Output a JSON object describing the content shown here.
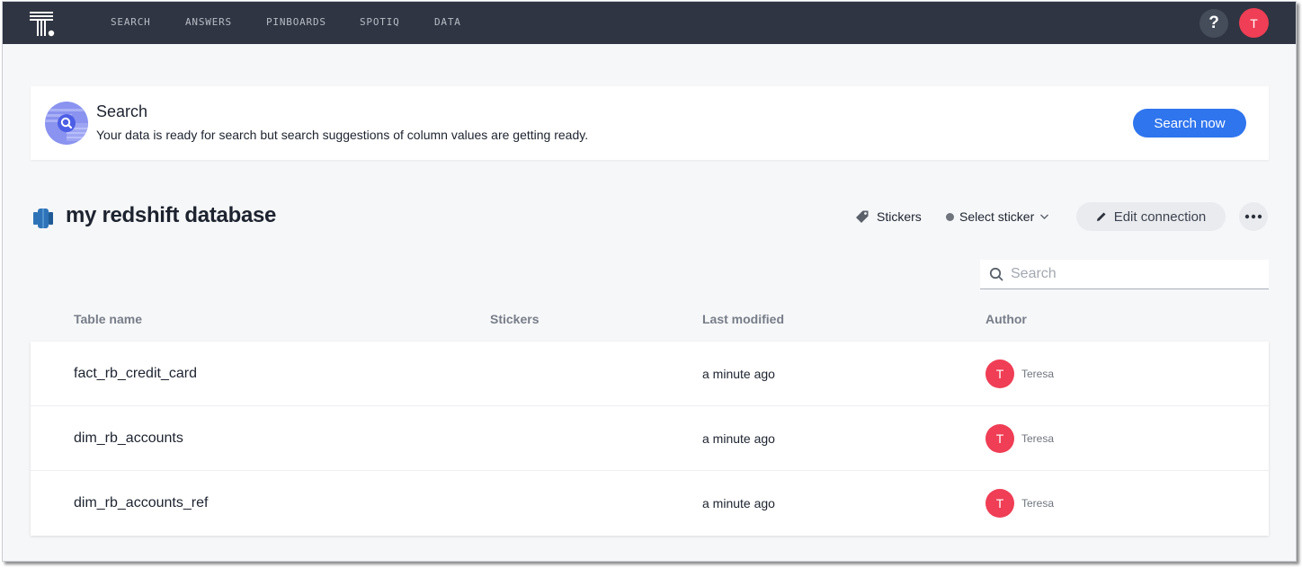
{
  "nav": {
    "logo": "thoughtspot-logo",
    "items": [
      {
        "label": "SEARCH"
      },
      {
        "label": "ANSWERS"
      },
      {
        "label": "PINBOARDS"
      },
      {
        "label": "SPOTIQ"
      },
      {
        "label": "DATA"
      }
    ],
    "help_label": "?",
    "user_initial": "T"
  },
  "banner": {
    "icon": "search-icon",
    "title": "Search",
    "message": "Your data is ready for search but search suggestions of column values are getting ready.",
    "button_label": "Search now"
  },
  "header": {
    "title": "my redshift database",
    "stickers_label": "Stickers",
    "select_sticker_label": "Select sticker",
    "edit_connection_label": "Edit connection"
  },
  "search": {
    "placeholder": "Search",
    "value": ""
  },
  "table": {
    "columns": [
      "Table name",
      "Stickers",
      "Last modified",
      "Author"
    ],
    "rows": [
      {
        "name": "fact_rb_credit_card",
        "stickers": "",
        "last_modified": "a minute ago",
        "author_initial": "T",
        "author": "Teresa"
      },
      {
        "name": "dim_rb_accounts",
        "stickers": "",
        "last_modified": "a minute ago",
        "author_initial": "T",
        "author": "Teresa"
      },
      {
        "name": "dim_rb_accounts_ref",
        "stickers": "",
        "last_modified": "a minute ago",
        "author_initial": "T",
        "author": "Teresa"
      }
    ]
  },
  "colors": {
    "nav_bg": "#2f3542",
    "primary": "#2f75ee",
    "avatar": "#ef3e55",
    "db_icon": "#2e73b8"
  }
}
